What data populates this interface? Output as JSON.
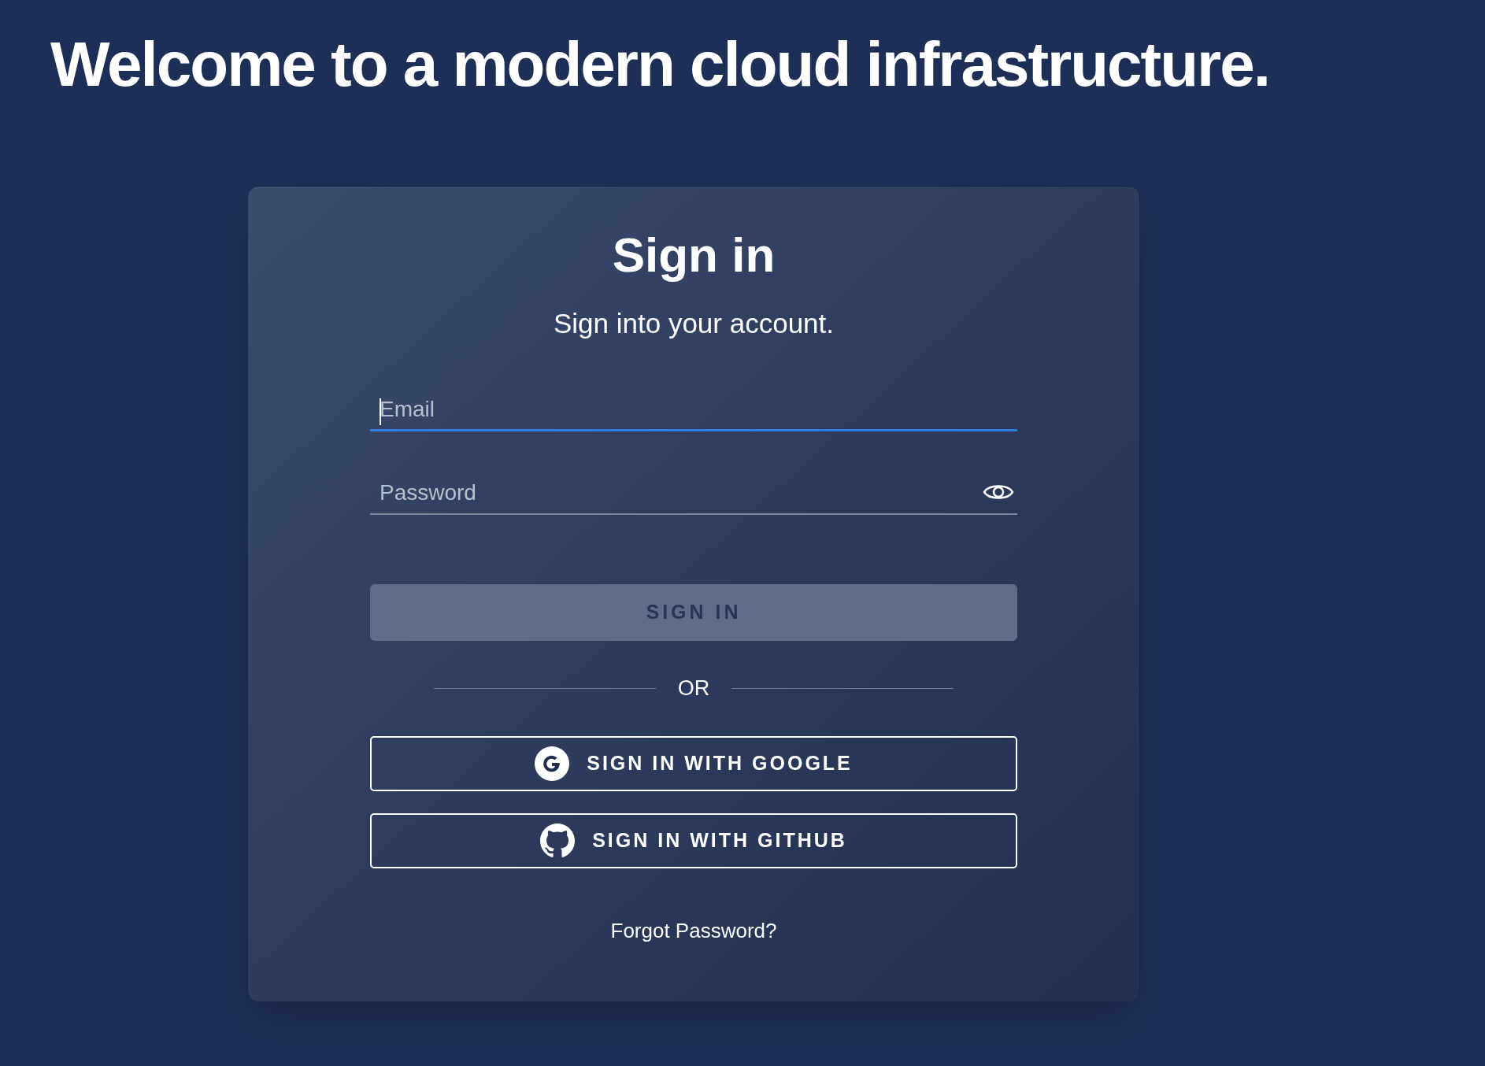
{
  "heading": "Welcome to a modern cloud infrastructure.",
  "card": {
    "title": "Sign in",
    "subtitle": "Sign into your account.",
    "fields": [
      {
        "kind": "email",
        "placeholder": "Email",
        "focused": true
      },
      {
        "kind": "password",
        "placeholder": "Password",
        "focused": false
      }
    ],
    "submit": {
      "label": "SIGN IN",
      "disabled": true
    },
    "divider": "OR",
    "providers": [
      {
        "kind": "google",
        "label": "SIGN IN WITH GOOGLE"
      },
      {
        "kind": "github",
        "label": "SIGN IN WITH GITHUB"
      }
    ],
    "forgot": "Forgot Password?"
  }
}
